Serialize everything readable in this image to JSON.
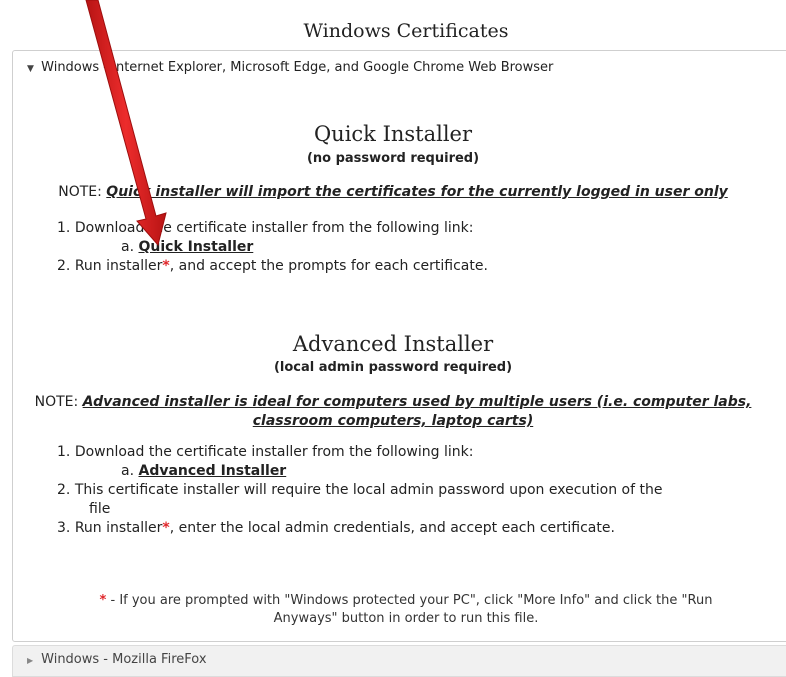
{
  "page": {
    "title": "Windows Certificates"
  },
  "panel": {
    "header": "Windows - Internet Explorer, Microsoft Edge, and Google Chrome Web Browser",
    "quick": {
      "title": "Quick Installer",
      "subtitle": "(no password required)",
      "note_prefix": "NOTE: ",
      "note": "Quick installer will import the certificates for the currently logged in user only",
      "step1": "Download the certificate installer from the following link:",
      "link_prefix": "a. ",
      "link": "Quick Installer",
      "step2_pre": "Run installer",
      "step2_post": ", and accept the prompts for each certificate."
    },
    "advanced": {
      "title": "Advanced Installer",
      "subtitle": "(local admin password required)",
      "note_prefix": "NOTE: ",
      "note_line1": "Advanced installer is ideal for computers used by multiple users (i.e. computer labs,",
      "note_line2": "classroom computers, laptop carts)",
      "step1": "Download the certificate installer from the following link:",
      "link_prefix": "a. ",
      "link": "Advanced Installer",
      "step2": "This certificate installer will require the local admin password upon execution of the",
      "step2_cont": "file",
      "step3_pre": "Run installer",
      "step3_post": ", enter the local admin credentials, and accept each certificate."
    },
    "footnote": {
      "star": "*",
      "line1": " - If you are prompted with \"Windows protected your PC\", click \"More Info\" and click the \"Run",
      "line2": "Anyways\" button in order to run this file."
    }
  },
  "collapsed": {
    "header": "Windows - Mozilla FireFox"
  },
  "colors": {
    "arrow": "#e0262a",
    "star": "#e0262a"
  }
}
